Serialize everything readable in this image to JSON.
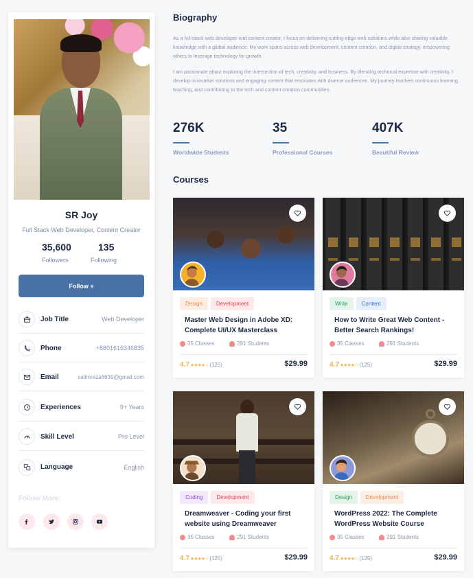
{
  "profile": {
    "name": "SR Joy",
    "role": "Full Stack Web Developer, Content Creator",
    "followers_count": "35,600",
    "followers_label": "Followers",
    "following_count": "135",
    "following_label": "Following",
    "follow_button": "Follow +",
    "info": [
      {
        "label": "Job Title",
        "value": "Web Developer",
        "icon": "briefcase-icon"
      },
      {
        "label": "Phone",
        "value": "+8801616346835",
        "icon": "phone-icon"
      },
      {
        "label": "Email",
        "value": "salimreza6835@gmail.com",
        "icon": "mail-icon"
      },
      {
        "label": "Experiences",
        "value": "9+ Years",
        "icon": "clock-icon"
      },
      {
        "label": "Skill Level",
        "value": "Pro Level",
        "icon": "gauge-icon"
      },
      {
        "label": "Language",
        "value": "English",
        "icon": "translate-icon"
      }
    ],
    "follow_more": "Follow More:",
    "social": [
      "facebook-icon",
      "twitter-icon",
      "instagram-icon",
      "youtube-icon"
    ]
  },
  "biography": {
    "title": "Biography",
    "paragraph1": "As a full-stack web developer and content creator, I focus on delivering cutting-edge web solutions while also sharing valuable knowledge with a global audience. My work spans across web development, content creation, and digital strategy, empowering others to leverage technology for growth.",
    "paragraph2": "I am passionate about exploring the intersection of tech, creativity, and business. By blending technical expertise with creativity, I develop innovative solutions and engaging content that resonates with diverse audiences. My journey involves continuous learning, teaching, and contributing to the tech and content creation communities."
  },
  "stats": [
    {
      "value": "276K",
      "label": "Worldwide Students"
    },
    {
      "value": "35",
      "label": "Professional Courses"
    },
    {
      "value": "407K",
      "label": "Beautiful Review"
    }
  ],
  "courses_title": "Courses",
  "courses": [
    {
      "tags": [
        {
          "text": "Design",
          "bg": "#fdeee4",
          "fg": "#e98a4e"
        },
        {
          "text": "Development",
          "bg": "#fde8ea",
          "fg": "#e0485a"
        }
      ],
      "title": "Master Web Design in Adobe XD: Complete UI/UX Masterclass",
      "classes": "35 Classes",
      "students": "291 Students",
      "rating": "4.7",
      "stars": "★★★★☆",
      "reviews": "(125)",
      "price": "$29.99"
    },
    {
      "tags": [
        {
          "text": "Write",
          "bg": "#e4f4ea",
          "fg": "#2f9a5a"
        },
        {
          "text": "Content",
          "bg": "#e6eefb",
          "fg": "#3f6fc4"
        }
      ],
      "title": "How to Write Great Web Content - Better Search Rankings!",
      "classes": "35 Classes",
      "students": "291 Students",
      "rating": "4.7",
      "stars": "★★★★☆",
      "reviews": "(125)",
      "price": "$29.99"
    },
    {
      "tags": [
        {
          "text": "Coding",
          "bg": "#f1e8fb",
          "fg": "#8a4fd0"
        },
        {
          "text": "Development",
          "bg": "#fde8ea",
          "fg": "#e0485a"
        }
      ],
      "title": "Dreamweaver - Coding your first website using Dreamweaver",
      "classes": "35 Classes",
      "students": "291 Students",
      "rating": "4.7",
      "stars": "★★★★☆",
      "reviews": "(125)",
      "price": "$29.99"
    },
    {
      "tags": [
        {
          "text": "Design",
          "bg": "#e4f4ea",
          "fg": "#2f9a5a"
        },
        {
          "text": "Development",
          "bg": "#fdeee4",
          "fg": "#e98a4e"
        }
      ],
      "title": "WordPress 2022: The Complete WordPress Website Course",
      "classes": "35 Classes",
      "students": "291 Students",
      "rating": "4.7",
      "stars": "★★★★☆",
      "reviews": "(125)",
      "price": "$29.99"
    }
  ],
  "colors": {
    "accent": "#4872a4",
    "rating": "#f1b34a",
    "heading": "#1d2a44"
  }
}
